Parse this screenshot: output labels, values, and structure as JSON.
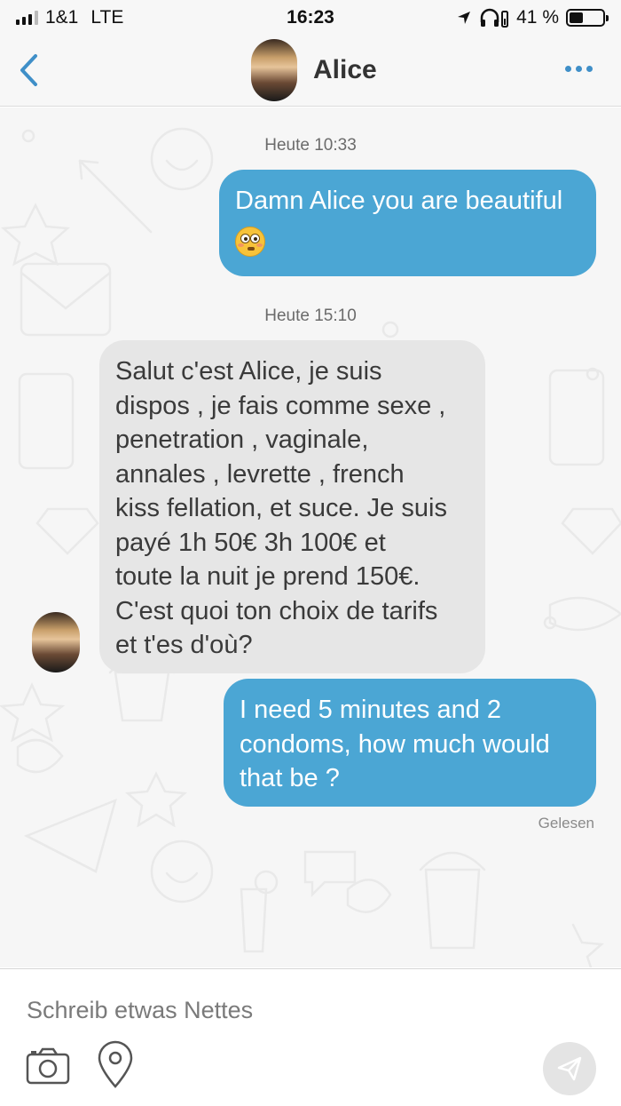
{
  "status_bar": {
    "carrier": "1&1",
    "network": "LTE",
    "time": "16:23",
    "battery_percent_text": "41 %",
    "battery_level": 0.41
  },
  "header": {
    "contact_name": "Alice",
    "back_icon": "chevron-left-icon",
    "more_icon": "more-dots-icon",
    "accent_color": "#3f8fc8"
  },
  "conversation": {
    "messages": [
      {
        "timestamp": "Heute 10:33",
        "direction": "outgoing",
        "lines": [
          "Damn Alice you are beautiful"
        ],
        "emoji": "flushed-face-icon"
      },
      {
        "timestamp": "Heute 15:10",
        "direction": "incoming",
        "lines": [
          "Salut c'est Alice, je suis",
          "dispos , je fais comme sexe ,",
          "penetration , vaginale,",
          "annales , levrette , french",
          "kiss fellation, et suce. Je suis",
          "payé 1h 50€ 3h 100€ et",
          "toute la nuit je prend 150€.",
          "C'est quoi ton choix de tarifs",
          "et t'es d'où?"
        ]
      },
      {
        "direction": "outgoing",
        "lines": [
          "I need 5 minutes and 2",
          "condoms, how much would",
          "that be ?"
        ],
        "status": "Gelesen"
      }
    ],
    "outgoing_color": "#4ba6d4",
    "incoming_color": "#e6e6e6"
  },
  "composer": {
    "placeholder": "Schreib etwas Nettes",
    "camera_icon": "camera-icon",
    "location_icon": "location-pin-icon",
    "send_icon": "send-icon"
  }
}
